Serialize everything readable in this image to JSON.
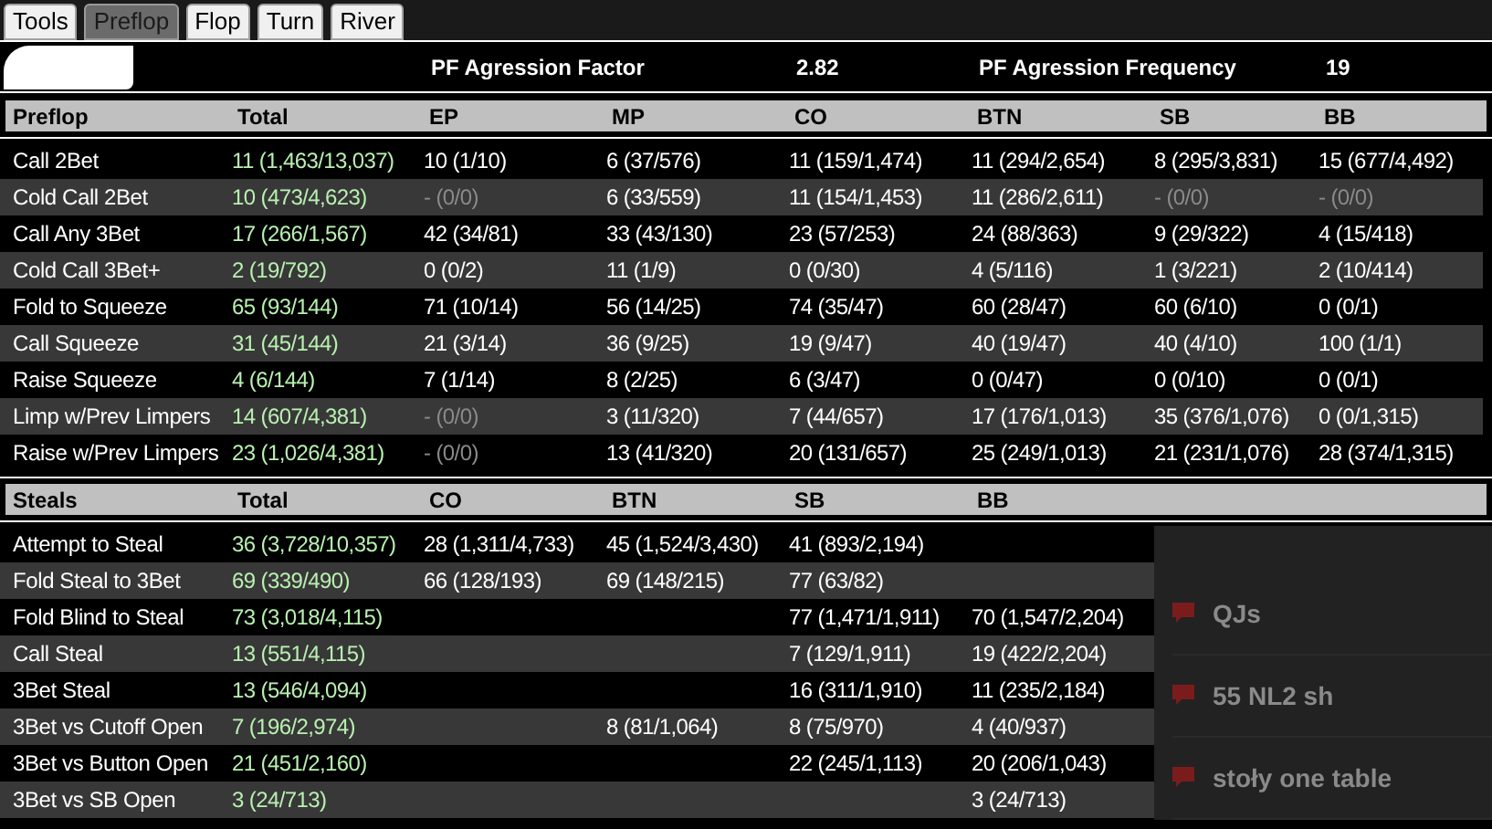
{
  "tabs": [
    {
      "label": "Tools",
      "selected": false
    },
    {
      "label": "Preflop",
      "selected": true
    },
    {
      "label": "Flop",
      "selected": false
    },
    {
      "label": "Turn",
      "selected": false
    },
    {
      "label": "River",
      "selected": false
    }
  ],
  "summary": [
    {
      "label": "PF Agression Factor",
      "value": "2.82"
    },
    {
      "label": "PF Agression Frequency",
      "value": "19"
    }
  ],
  "sections": [
    {
      "columns": [
        "Preflop",
        "Total",
        "EP",
        "MP",
        "CO",
        "BTN",
        "SB",
        "BB"
      ],
      "rows": [
        {
          "cells": [
            "Call 2Bet",
            "11 (1,463/13,037)",
            "10 (1/10)",
            "6 (37/576)",
            "11 (159/1,474)",
            "11 (294/2,654)",
            "8 (295/3,831)",
            "15 (677/4,492)"
          ]
        },
        {
          "cells": [
            "Cold Call 2Bet",
            "10 (473/4,623)",
            {
              "text": "- (0/0)",
              "dimmed": true
            },
            "6 (33/559)",
            "11 (154/1,453)",
            "11 (286/2,611)",
            {
              "text": "- (0/0)",
              "dimmed": true
            },
            {
              "text": "- (0/0)",
              "dimmed": true
            }
          ]
        },
        {
          "cells": [
            "Call Any 3Bet",
            "17 (266/1,567)",
            "42 (34/81)",
            "33 (43/130)",
            "23 (57/253)",
            "24 (88/363)",
            "9 (29/322)",
            "4 (15/418)"
          ]
        },
        {
          "cells": [
            "Cold Call 3Bet+",
            "2 (19/792)",
            "0 (0/2)",
            "11 (1/9)",
            "0 (0/30)",
            "4 (5/116)",
            "1 (3/221)",
            "2 (10/414)"
          ]
        },
        {
          "cells": [
            "Fold to Squeeze",
            "65 (93/144)",
            "71 (10/14)",
            "56 (14/25)",
            "74 (35/47)",
            "60 (28/47)",
            "60 (6/10)",
            "0 (0/1)"
          ]
        },
        {
          "cells": [
            "Call Squeeze",
            "31 (45/144)",
            "21 (3/14)",
            "36 (9/25)",
            "19 (9/47)",
            "40 (19/47)",
            "40 (4/10)",
            "100 (1/1)"
          ]
        },
        {
          "cells": [
            "Raise Squeeze",
            "4 (6/144)",
            "7 (1/14)",
            "8 (2/25)",
            "6 (3/47)",
            "0 (0/47)",
            "0 (0/10)",
            "0 (0/1)"
          ]
        },
        {
          "cells": [
            "Limp w/Prev Limpers",
            "14 (607/4,381)",
            {
              "text": "- (0/0)",
              "dimmed": true
            },
            "3 (11/320)",
            "7 (44/657)",
            "17 (176/1,013)",
            "35 (376/1,076)",
            "0 (0/1,315)"
          ]
        },
        {
          "cells": [
            "Raise w/Prev Limpers",
            "23 (1,026/4,381)",
            {
              "text": "- (0/0)",
              "dimmed": true
            },
            "13 (41/320)",
            "20 (131/657)",
            "25 (249/1,013)",
            "21 (231/1,076)",
            "28 (374/1,315)"
          ]
        }
      ]
    },
    {
      "columns": [
        "Steals",
        "Total",
        "CO",
        "BTN",
        "SB",
        "BB"
      ],
      "rows": [
        {
          "cells": [
            "Attempt to Steal",
            "36 (3,728/10,357)",
            "28 (1,311/4,733)",
            "45 (1,524/3,430)",
            "41 (893/2,194)",
            null
          ]
        },
        {
          "cells": [
            "Fold Steal to 3Bet",
            "69 (339/490)",
            "66 (128/193)",
            "69 (148/215)",
            "77 (63/82)",
            null
          ]
        },
        {
          "cells": [
            "Fold Blind to Steal",
            "73 (3,018/4,115)",
            null,
            null,
            "77 (1,471/1,911)",
            "70 (1,547/2,204)"
          ]
        },
        {
          "cells": [
            "Call Steal",
            "13 (551/4,115)",
            null,
            null,
            "7 (129/1,911)",
            "19 (422/2,204)"
          ]
        },
        {
          "cells": [
            "3Bet Steal",
            "13 (546/4,094)",
            null,
            null,
            "16 (311/1,910)",
            "11 (235/2,184)"
          ]
        },
        {
          "cells": [
            "3Bet vs Cutoff Open",
            "7 (196/2,974)",
            null,
            "8 (81/1,064)",
            "8 (75/970)",
            "4 (40/937)"
          ]
        },
        {
          "cells": [
            "3Bet vs Button Open",
            "21 (451/2,160)",
            null,
            null,
            "22 (245/1,113)",
            "20 (206/1,043)"
          ]
        },
        {
          "cells": [
            "3Bet vs SB Open",
            "3 (24/713)",
            null,
            null,
            null,
            "3 (24/713)"
          ]
        }
      ]
    }
  ],
  "background_topics": [
    "QJs",
    "55 NL2 sh",
    "stoły one table"
  ]
}
